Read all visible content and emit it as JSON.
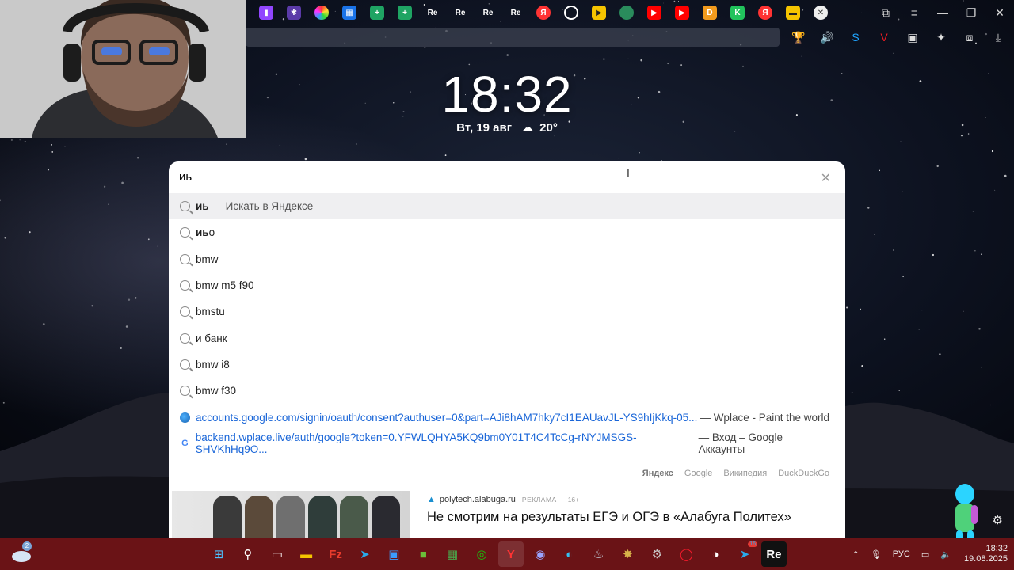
{
  "clock": {
    "time": "18:32",
    "date": "Вт, 19 авг",
    "temperature": "20°"
  },
  "search": {
    "query": "иь",
    "suggestions": [
      {
        "bold": "иь",
        "rest": " — Искать в Яндексе"
      },
      {
        "bold": "иь",
        "rest": "о"
      },
      {
        "bold": "",
        "rest": "bmw"
      },
      {
        "bold": "",
        "rest": "bmw m5 f90"
      },
      {
        "bold": "",
        "rest": "bmstu"
      },
      {
        "bold": "",
        "rest": "и банк"
      },
      {
        "bold": "",
        "rest": "bmw i8"
      },
      {
        "bold": "",
        "rest": "bmw f30"
      }
    ],
    "links": [
      {
        "url": "accounts.google.com/signin/oauth/consent?authuser=0&part=AJi8hAM7hky7cI1EAUavJL-YS9hIjKkq-05...",
        "title": "— Wplace - Paint the world"
      },
      {
        "url": "backend.wplace.live/auth/google?token=0.YFWLQHYA5KQ9bm0Y01T4C4TcCg-rNYJMSGS-SHVKhHq9O...",
        "title": "— Вход – Google Аккаунты"
      }
    ],
    "engines": [
      "Яндекс",
      "Google",
      "Википедия",
      "DuckDuckGo"
    ]
  },
  "news": {
    "source": "polytech.alabuga.ru",
    "ad_label": "РЕКЛАМА",
    "age": "16+",
    "title": "Не смотрим на результаты ЕГЭ и ОГЭ в «Алабуга Политех»"
  },
  "taskbar": {
    "notification_count": "2",
    "telegram_badge": "16",
    "language": "РУС",
    "time": "18:32",
    "date": "19.08.2025"
  },
  "colors": {
    "taskbar": "#6a1316",
    "accent": "#1a66d8"
  }
}
